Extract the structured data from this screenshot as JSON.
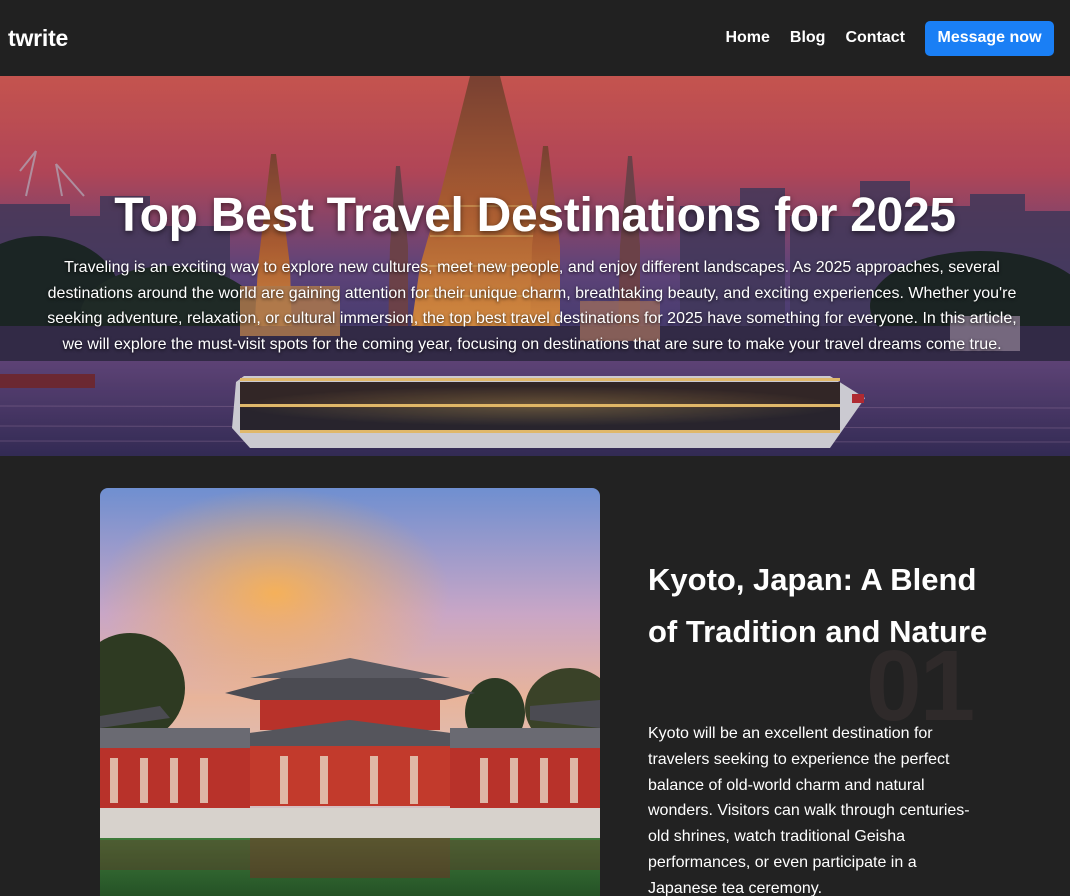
{
  "navbar": {
    "brand": "twrite",
    "links": [
      "Home",
      "Blog",
      "Contact"
    ],
    "cta_label": "Message now",
    "accent_color": "#1a7ff5"
  },
  "hero": {
    "title": "Top Best Travel Destinations for 2025",
    "text": "Traveling is an exciting way to explore new cultures, meet new people, and enjoy different landscapes. As 2025 approaches, several destinations around the world are gaining attention for their unique charm, breathtaking beauty, and exciting experiences. Whether you're seeking adventure, relaxation, or cultural immersion, the top best travel destinations for 2025 have something for everyone. In this article, we will explore the must-visit spots for the coming year, focusing on destinations that are sure to make your travel dreams come true."
  },
  "article": {
    "number": "01",
    "title": "Kyoto, Japan: A Blend of Tradition and Nature",
    "body": "Kyoto will be an excellent destination for travelers seeking to experience the perfect balance of old-world charm and natural wonders. Visitors can walk through centuries-old shrines, watch traditional Geisha performances, or even participate in a Japanese tea ceremony."
  }
}
